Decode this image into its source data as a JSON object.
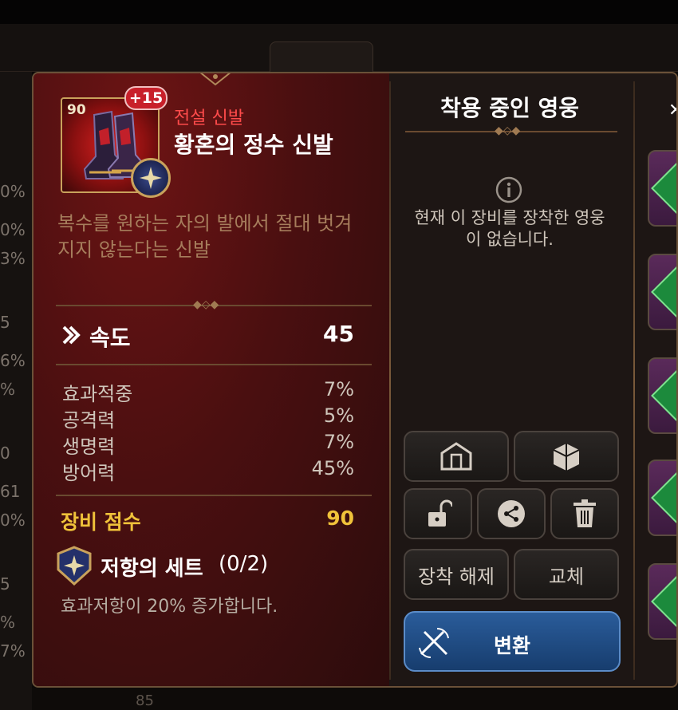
{
  "background": {
    "left_values": [
      "0%",
      "0%",
      "3%",
      "5",
      "6%",
      "%",
      "0",
      "61",
      "0%",
      "5",
      "%",
      "7%"
    ],
    "bottom_text": "85"
  },
  "item": {
    "level": "90",
    "enhance": "+15",
    "grade": "전설 신발",
    "name": "황혼의 정수 신발",
    "description": "복수를 원하는 자의 발에서 절대 벗겨지지 않는다는 신발"
  },
  "main_stat": {
    "icon": "speed-chevron-icon",
    "label": "속도",
    "value": "45"
  },
  "sub_stats": [
    {
      "label": "효과적중",
      "value": "7%"
    },
    {
      "label": "공격력",
      "value": "5%"
    },
    {
      "label": "생명력",
      "value": "7%"
    },
    {
      "label": "방어력",
      "value": "45%"
    }
  ],
  "score": {
    "label": "장비 점수",
    "value": "90"
  },
  "set": {
    "name": "저항의 세트",
    "count": "(0/2)",
    "description": "효과저항이 20% 증가합니다."
  },
  "hero_panel": {
    "title": "착용 중인 영웅",
    "empty_message": "현재 이 장비를 장착한 영웅이 없습니다."
  },
  "buttons": {
    "unequip": "장착 해제",
    "replace": "교체",
    "convert": "변환"
  },
  "colors": {
    "grade_legendary": "#ff4b4b",
    "score": "#f0c23a",
    "convert_button": "#2a5c9a",
    "panel_red": "#6d1414"
  }
}
